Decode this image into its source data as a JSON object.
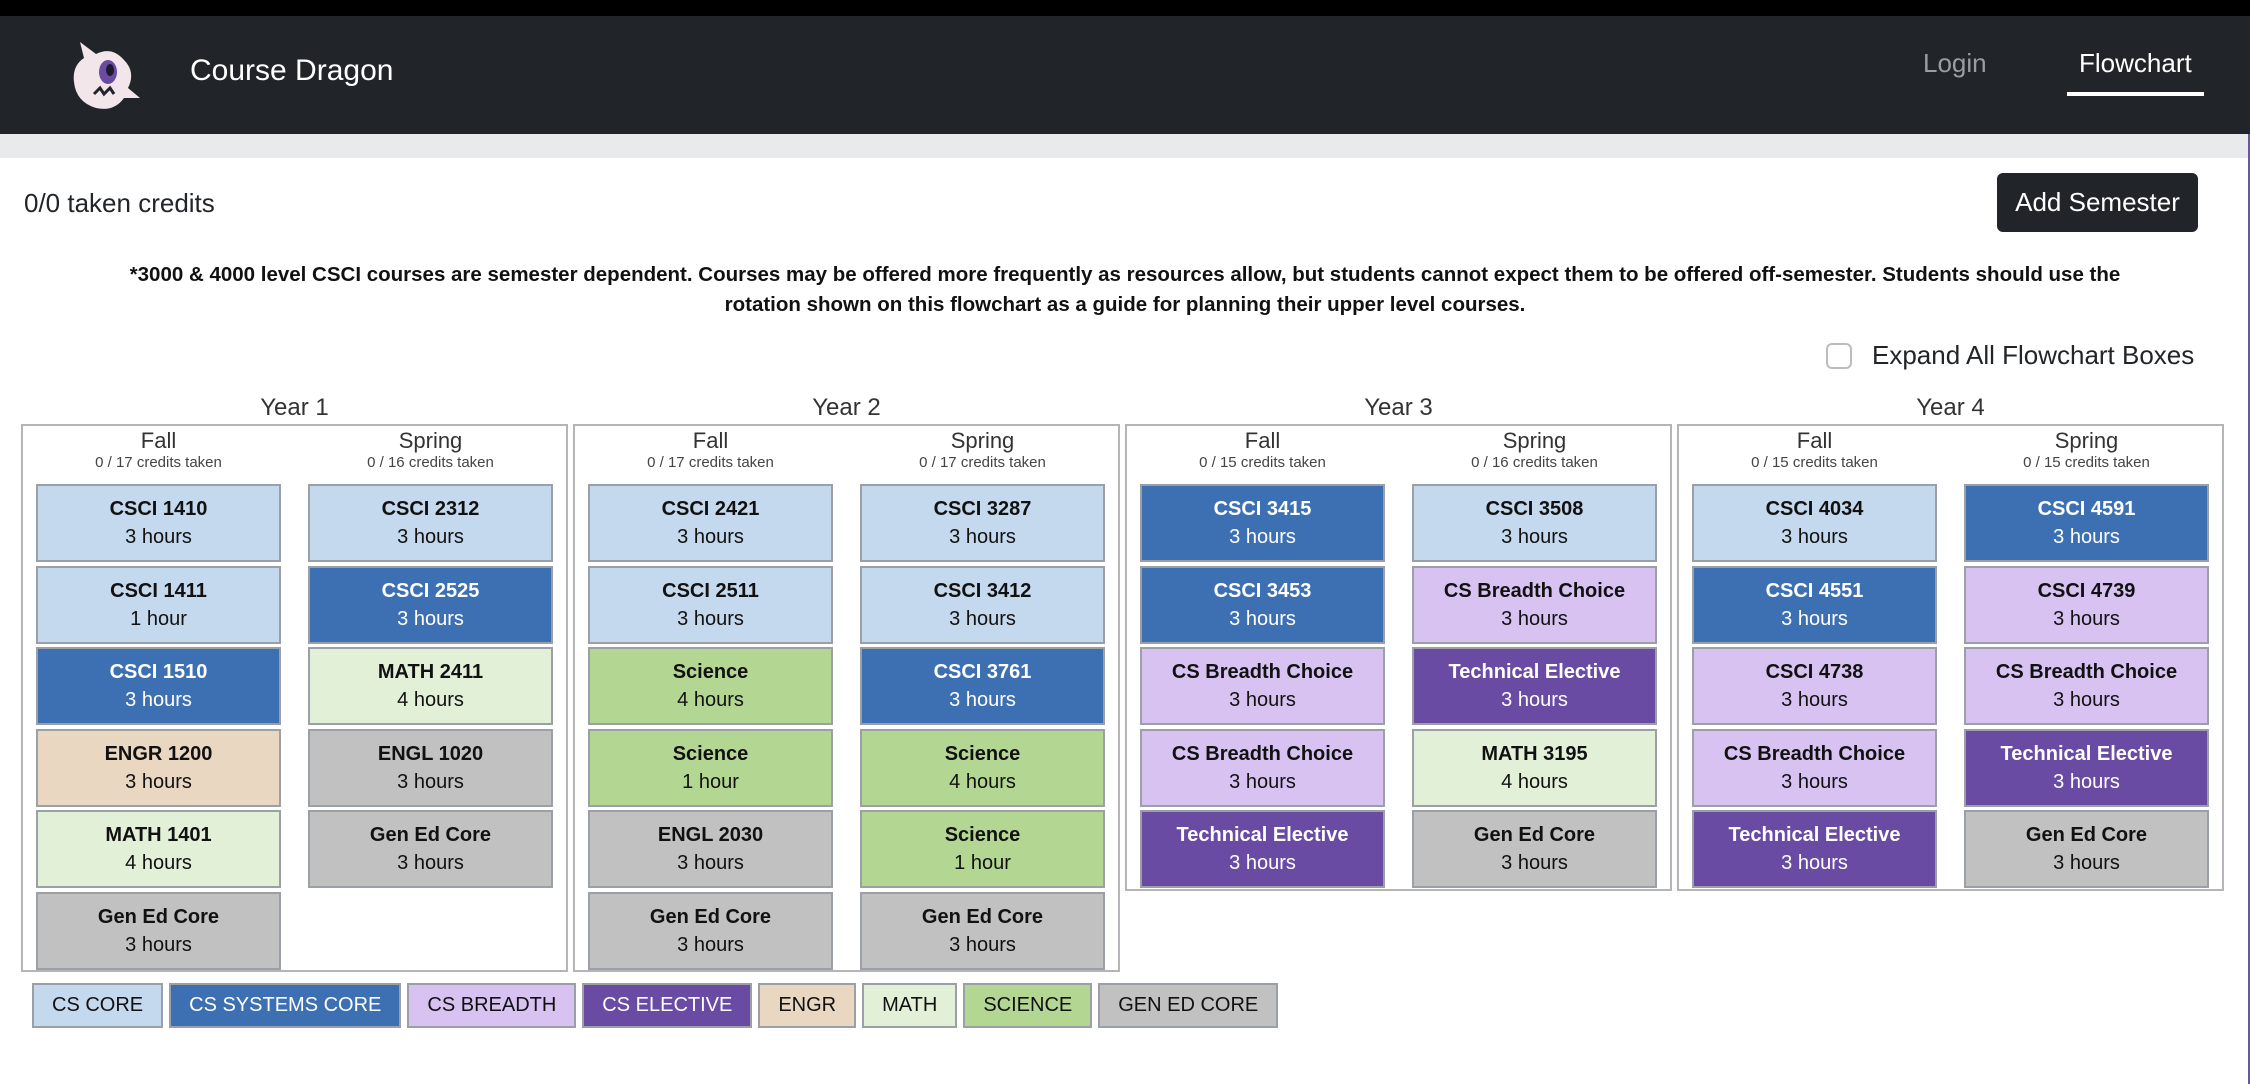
{
  "navbar": {
    "brand": "Course Dragon",
    "login": "Login",
    "flowchart": "Flowchart",
    "logo_icon": "dragon-logo-icon"
  },
  "toolbar": {
    "credits": "0/0 taken credits",
    "add_semester": "Add Semester"
  },
  "notice": "*3000 & 4000 level CSCI courses are semester dependent. Courses may be offered more frequently as resources allow, but students cannot expect them to be offered off-semester. Students should use the rotation shown on this flowchart as a guide for planning their upper level courses.",
  "expand_label": "Expand All Flowchart Boxes",
  "colors": {
    "cs_core": "#c5d9ee",
    "cs_systems_core": "#3d70b2",
    "cs_breadth": "#d8c2f2",
    "cs_elective": "#6a4ba3",
    "engr": "#ead7c1",
    "math": "#e2f0d8",
    "science": "#b4d693",
    "gen_ed": "#c1c1c1"
  },
  "years": [
    {
      "title": "Year 1",
      "semesters": [
        {
          "name": "Fall",
          "credits": "0 / 17 credits taken",
          "courses": [
            {
              "name": "CSCI 1410",
              "hours": "3 hours",
              "type": "cs-core"
            },
            {
              "name": "CSCI 1411",
              "hours": "1 hour",
              "type": "cs-core"
            },
            {
              "name": "CSCI 1510",
              "hours": "3 hours",
              "type": "cs-sys"
            },
            {
              "name": "ENGR 1200",
              "hours": "3 hours",
              "type": "engr"
            },
            {
              "name": "MATH 1401",
              "hours": "4 hours",
              "type": "math"
            },
            {
              "name": "Gen Ed Core",
              "hours": "3 hours",
              "type": "gened"
            }
          ]
        },
        {
          "name": "Spring",
          "credits": "0 / 16 credits taken",
          "courses": [
            {
              "name": "CSCI 2312",
              "hours": "3 hours",
              "type": "cs-core"
            },
            {
              "name": "CSCI 2525",
              "hours": "3 hours",
              "type": "cs-sys"
            },
            {
              "name": "MATH 2411",
              "hours": "4 hours",
              "type": "math"
            },
            {
              "name": "ENGL 1020",
              "hours": "3 hours",
              "type": "gened"
            },
            {
              "name": "Gen Ed Core",
              "hours": "3 hours",
              "type": "gened"
            }
          ]
        }
      ]
    },
    {
      "title": "Year 2",
      "semesters": [
        {
          "name": "Fall",
          "credits": "0 / 17 credits taken",
          "courses": [
            {
              "name": "CSCI 2421",
              "hours": "3 hours",
              "type": "cs-core"
            },
            {
              "name": "CSCI 2511",
              "hours": "3 hours",
              "type": "cs-core"
            },
            {
              "name": "Science",
              "hours": "4 hours",
              "type": "science"
            },
            {
              "name": "Science",
              "hours": "1 hour",
              "type": "science"
            },
            {
              "name": "ENGL 2030",
              "hours": "3 hours",
              "type": "gened"
            },
            {
              "name": "Gen Ed Core",
              "hours": "3 hours",
              "type": "gened"
            }
          ]
        },
        {
          "name": "Spring",
          "credits": "0 / 17 credits taken",
          "courses": [
            {
              "name": "CSCI 3287",
              "hours": "3 hours",
              "type": "cs-core"
            },
            {
              "name": "CSCI 3412",
              "hours": "3 hours",
              "type": "cs-core"
            },
            {
              "name": "CSCI 3761",
              "hours": "3 hours",
              "type": "cs-sys"
            },
            {
              "name": "Science",
              "hours": "4 hours",
              "type": "science"
            },
            {
              "name": "Science",
              "hours": "1 hour",
              "type": "science"
            },
            {
              "name": "Gen Ed Core",
              "hours": "3 hours",
              "type": "gened"
            }
          ]
        }
      ]
    },
    {
      "title": "Year 3",
      "semesters": [
        {
          "name": "Fall",
          "credits": "0 / 15 credits taken",
          "courses": [
            {
              "name": "CSCI 3415",
              "hours": "3 hours",
              "type": "cs-sys"
            },
            {
              "name": "CSCI 3453",
              "hours": "3 hours",
              "type": "cs-sys"
            },
            {
              "name": "CS Breadth Choice",
              "hours": "3 hours",
              "type": "cs-breadth"
            },
            {
              "name": "CS Breadth Choice",
              "hours": "3 hours",
              "type": "cs-breadth"
            },
            {
              "name": "Technical Elective",
              "hours": "3 hours",
              "type": "cs-elective"
            }
          ]
        },
        {
          "name": "Spring",
          "credits": "0 / 16 credits taken",
          "courses": [
            {
              "name": "CSCI 3508",
              "hours": "3 hours",
              "type": "cs-core"
            },
            {
              "name": "CS Breadth Choice",
              "hours": "3 hours",
              "type": "cs-breadth"
            },
            {
              "name": "Technical Elective",
              "hours": "3 hours",
              "type": "cs-elective"
            },
            {
              "name": "MATH 3195",
              "hours": "4 hours",
              "type": "math"
            },
            {
              "name": "Gen Ed Core",
              "hours": "3 hours",
              "type": "gened"
            }
          ]
        }
      ]
    },
    {
      "title": "Year 4",
      "semesters": [
        {
          "name": "Fall",
          "credits": "0 / 15 credits taken",
          "courses": [
            {
              "name": "CSCI 4034",
              "hours": "3 hours",
              "type": "cs-core"
            },
            {
              "name": "CSCI 4551",
              "hours": "3 hours",
              "type": "cs-sys"
            },
            {
              "name": "CSCI 4738",
              "hours": "3 hours",
              "type": "cs-breadth"
            },
            {
              "name": "CS Breadth Choice",
              "hours": "3 hours",
              "type": "cs-breadth"
            },
            {
              "name": "Technical Elective",
              "hours": "3 hours",
              "type": "cs-elective"
            }
          ]
        },
        {
          "name": "Spring",
          "credits": "0 / 15 credits taken",
          "courses": [
            {
              "name": "CSCI 4591",
              "hours": "3 hours",
              "type": "cs-sys"
            },
            {
              "name": "CSCI 4739",
              "hours": "3 hours",
              "type": "cs-breadth"
            },
            {
              "name": "CS Breadth Choice",
              "hours": "3 hours",
              "type": "cs-breadth"
            },
            {
              "name": "Technical Elective",
              "hours": "3 hours",
              "type": "cs-elective"
            },
            {
              "name": "Gen Ed Core",
              "hours": "3 hours",
              "type": "gened"
            }
          ]
        }
      ]
    }
  ],
  "legend": [
    {
      "label": "CS CORE",
      "type": "cs-core"
    },
    {
      "label": "CS SYSTEMS CORE",
      "type": "cs-sys"
    },
    {
      "label": "CS BREADTH",
      "type": "cs-breadth"
    },
    {
      "label": "CS ELECTIVE",
      "type": "cs-elective"
    },
    {
      "label": "ENGR",
      "type": "engr"
    },
    {
      "label": "MATH",
      "type": "math"
    },
    {
      "label": "SCIENCE",
      "type": "science"
    },
    {
      "label": "GEN ED CORE",
      "type": "gened"
    }
  ]
}
